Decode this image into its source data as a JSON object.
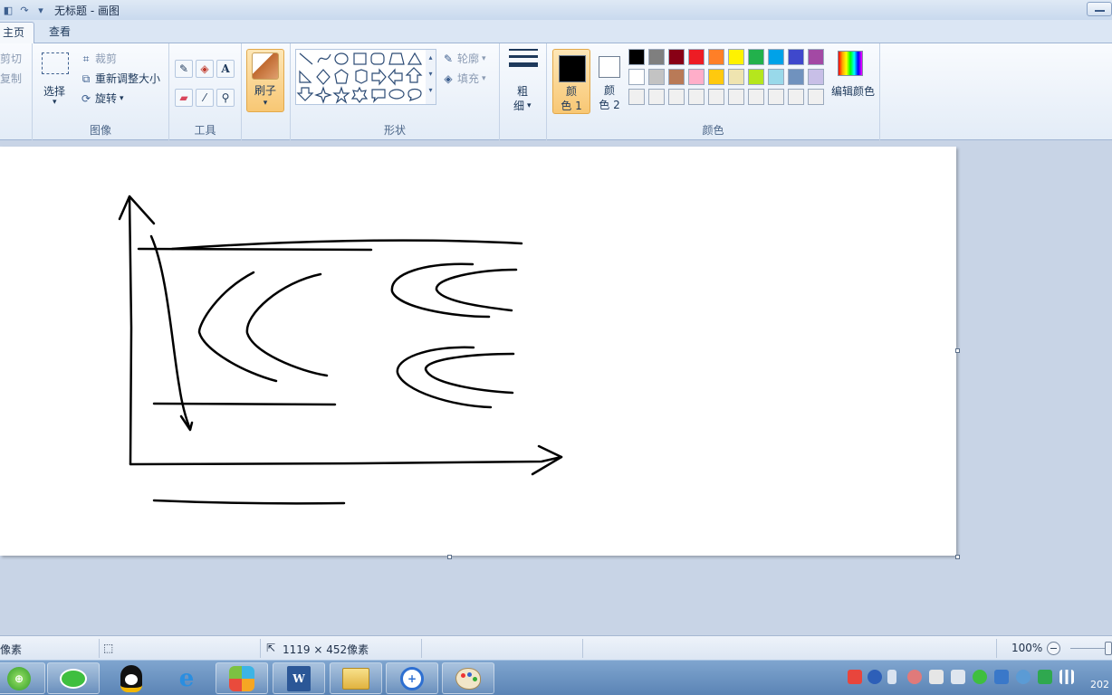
{
  "window": {
    "title": "无标题 - 画图"
  },
  "tabs": [
    {
      "label": "主页"
    },
    {
      "label": "查看"
    }
  ],
  "clipboard": {
    "cut": "剪切",
    "copy": "复制"
  },
  "image": {
    "select": "选择",
    "crop": "裁剪",
    "resize": "重新调整大小",
    "rotate": "旋转",
    "group_label": "图像"
  },
  "tools": {
    "group_label": "工具",
    "text_icon": "A"
  },
  "brushes": {
    "label": "刷子"
  },
  "shapes": {
    "group_label": "形状",
    "outline": "轮廓",
    "fill": "填充"
  },
  "size": {
    "label_line1": "粗",
    "label_line2": "细"
  },
  "colors": {
    "color1_line1": "颜",
    "color1_line2": "色 1",
    "color2_line1": "颜",
    "color2_line2": "色 2",
    "edit_colors": "编辑颜色",
    "group_label": "颜色",
    "color1_value": "#000000",
    "color2_value": "#ffffff",
    "palette_row1": [
      "#000000",
      "#7f7f7f",
      "#880015",
      "#ed1c24",
      "#ff7f27",
      "#fff200",
      "#22b14c",
      "#00a2e8",
      "#3f48cc",
      "#a349a4"
    ],
    "palette_row2": [
      "#ffffff",
      "#c3c3c3",
      "#b97a57",
      "#ffaec9",
      "#ffc90e",
      "#efe4b0",
      "#b5e61d",
      "#99d9ea",
      "#7092be",
      "#c8bfe7"
    ],
    "palette_row3": [
      "#f0f0f0",
      "#f0f0f0",
      "#f0f0f0",
      "#f0f0f0",
      "#f0f0f0",
      "#f0f0f0",
      "#f0f0f0",
      "#f0f0f0",
      "#f0f0f0",
      "#f0f0f0"
    ]
  },
  "status": {
    "cursor_pos": "像素",
    "canvas_size": "1119 × 452像素",
    "zoom": "100%"
  },
  "taskbar": {
    "apps": [
      "360-icon",
      "wechat-icon",
      "qq-icon",
      "ie-icon",
      "app-store-icon",
      "word-icon",
      "explorer-icon",
      "sync-icon",
      "paint-icon"
    ],
    "clock": "202"
  }
}
